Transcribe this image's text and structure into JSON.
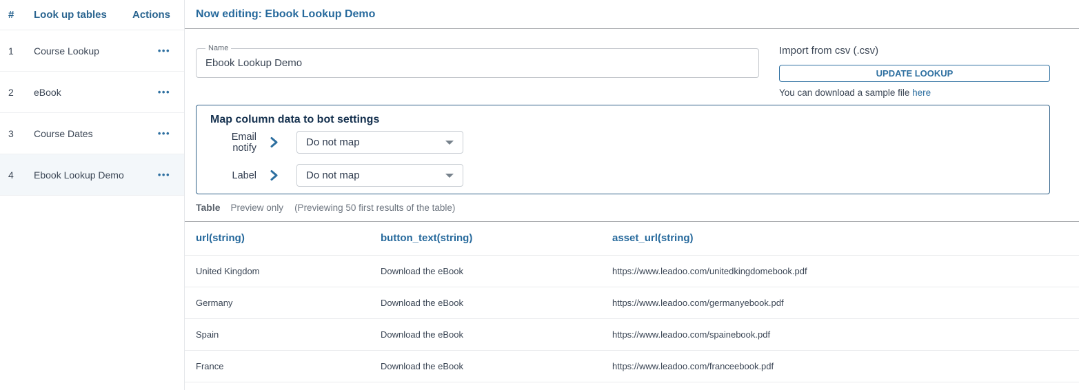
{
  "colors": {
    "accent_blue": "#26699C",
    "button_blue": "#2D6FA0",
    "heading_navy": "#14304E",
    "selected_row_bg": "#F3F7FA"
  },
  "icons": {
    "actions_menu": "more-horizontal",
    "actions_menu_glyph": "•••",
    "mapping_arrow": "chevron-right",
    "dropdown_caret": "caret-down"
  },
  "sidebar": {
    "header": {
      "index_label": "#",
      "name_label": "Look up tables",
      "actions_label": "Actions"
    },
    "items": [
      {
        "index": "1",
        "name": "Course Lookup",
        "selected": false
      },
      {
        "index": "2",
        "name": "eBook",
        "selected": false
      },
      {
        "index": "3",
        "name": "Course Dates",
        "selected": false
      },
      {
        "index": "4",
        "name": "Ebook Lookup Demo",
        "selected": true
      }
    ]
  },
  "header": {
    "title": "Now editing: Ebook Lookup Demo"
  },
  "editor": {
    "name_field": {
      "label": "Name",
      "value": "Ebook Lookup Demo"
    },
    "import": {
      "label": "Import from csv (.csv)",
      "button": "UPDATE LOOKUP",
      "hint_prefix": "You can download a sample file ",
      "hint_link": "here"
    },
    "mapping": {
      "title": "Map column data to bot settings",
      "rows": [
        {
          "label": "Email notify",
          "value": "Do not map"
        },
        {
          "label": "Label",
          "value": "Do not map"
        }
      ]
    },
    "table_meta": {
      "title": "Table",
      "mode": "Preview only",
      "note": "(Previewing 50 first results of the table)"
    }
  },
  "table": {
    "headers": [
      "url(string)",
      "button_text(string)",
      "asset_url(string)"
    ],
    "rows": [
      [
        "United Kingdom",
        "Download the eBook",
        "https://www.leadoo.com/unitedkingdomebook.pdf"
      ],
      [
        "Germany",
        "Download the eBook",
        "https://www.leadoo.com/germanyebook.pdf"
      ],
      [
        "Spain",
        "Download the eBook",
        "https://www.leadoo.com/spainebook.pdf"
      ],
      [
        "France",
        "Download the eBook",
        "https://www.leadoo.com/franceebook.pdf"
      ]
    ]
  }
}
